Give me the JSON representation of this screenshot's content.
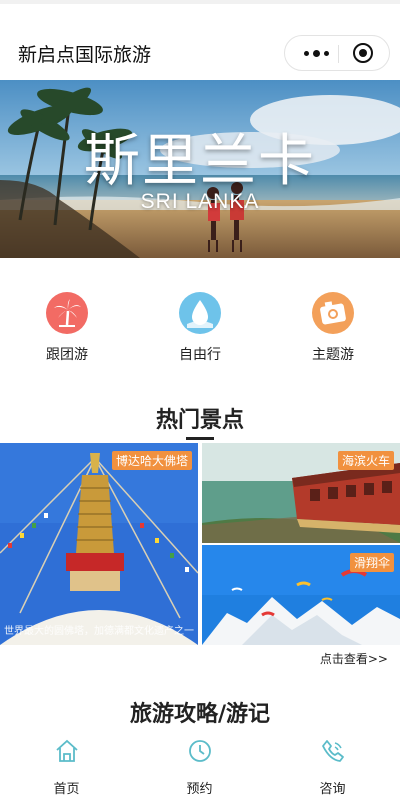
{
  "nav": {
    "title": "新启点国际旅游"
  },
  "banner": {
    "title": "斯里兰卡",
    "subtitle": "SRI LANKA"
  },
  "categories": [
    {
      "label": "跟团游",
      "icon": "palm-tree-icon",
      "color": "#f26b64"
    },
    {
      "label": "自由行",
      "icon": "water-drop-icon",
      "color": "#6ec3ea"
    },
    {
      "label": "主题游",
      "icon": "camera-icon",
      "color": "#f3a05a"
    }
  ],
  "hot_spots": {
    "title": "热门景点",
    "items": [
      {
        "tag": "博达哈大佛塔",
        "caption": "世界最大的圆佛塔，加德满都文化遗产之一"
      },
      {
        "tag": "海滨火车"
      },
      {
        "tag": "滑翔伞"
      }
    ],
    "more_link": "点击查看>>"
  },
  "guides": {
    "title": "旅游攻略/游记"
  },
  "tabbar": [
    {
      "label": "首页",
      "icon": "home-icon"
    },
    {
      "label": "预约",
      "icon": "clock-icon"
    },
    {
      "label": "咨询",
      "icon": "phone-icon"
    }
  ],
  "colors": {
    "accent": "#5bbcc9",
    "tag": "#f1913f"
  }
}
